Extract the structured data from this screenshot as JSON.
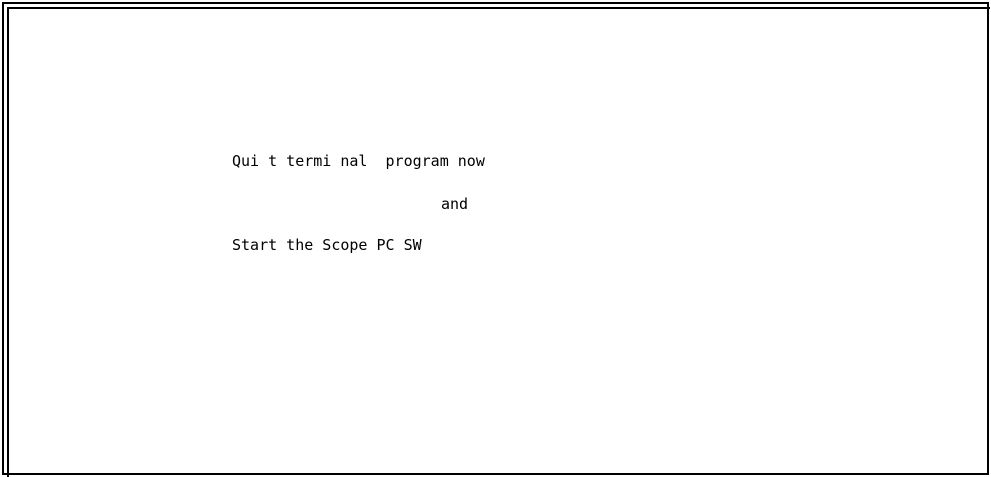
{
  "message": {
    "line1": "Qui t termi nal  program now",
    "line2": "and",
    "line3": "Start the Scope PC SW"
  }
}
